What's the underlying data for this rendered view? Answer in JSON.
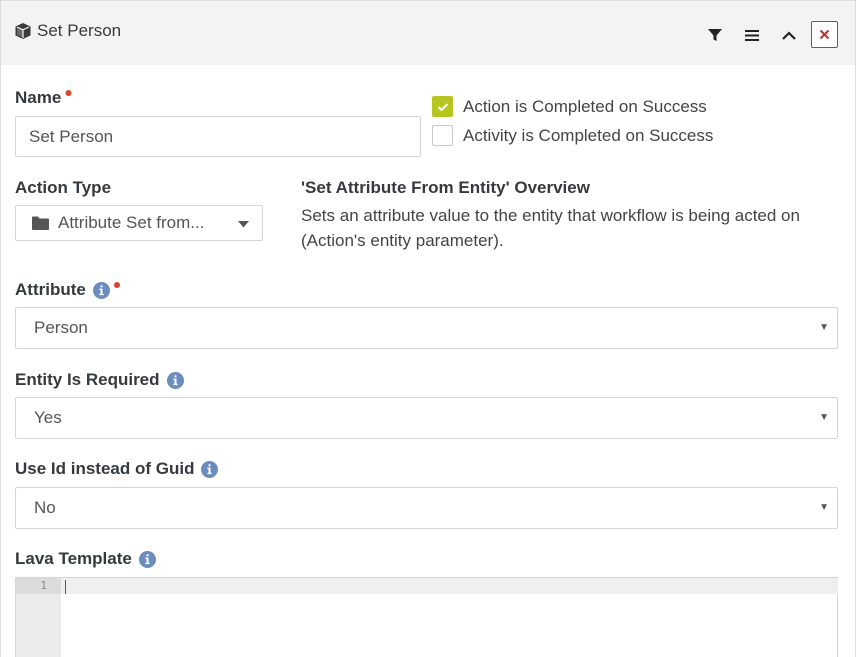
{
  "header": {
    "title": "Set Person",
    "icons": [
      "cube-icon",
      "filter-icon",
      "menu-icon",
      "chevron-up-icon",
      "close-icon"
    ]
  },
  "name_field": {
    "label": "Name",
    "value": "Set Person"
  },
  "checkboxes": [
    {
      "label": "Action is Completed on Success",
      "checked": true
    },
    {
      "label": "Activity is Completed on Success",
      "checked": false
    }
  ],
  "action_type": {
    "label": "Action Type",
    "value": "Attribute Set from..."
  },
  "overview": {
    "title": "'Set Attribute From Entity' Overview",
    "text": "Sets an attribute value to the entity that workflow is being acted on (Action's entity parameter)."
  },
  "attribute": {
    "label": "Attribute",
    "value": "Person"
  },
  "entity_required": {
    "label": "Entity Is Required",
    "value": "Yes"
  },
  "use_id": {
    "label": "Use Id instead of Guid",
    "value": "No"
  },
  "lava_template": {
    "label": "Lava Template",
    "line_number": "1"
  },
  "colors": {
    "accent_check": "#b6c51f",
    "required": "#d9432f",
    "info": "#6b8cbf",
    "close": "#c0392b"
  }
}
